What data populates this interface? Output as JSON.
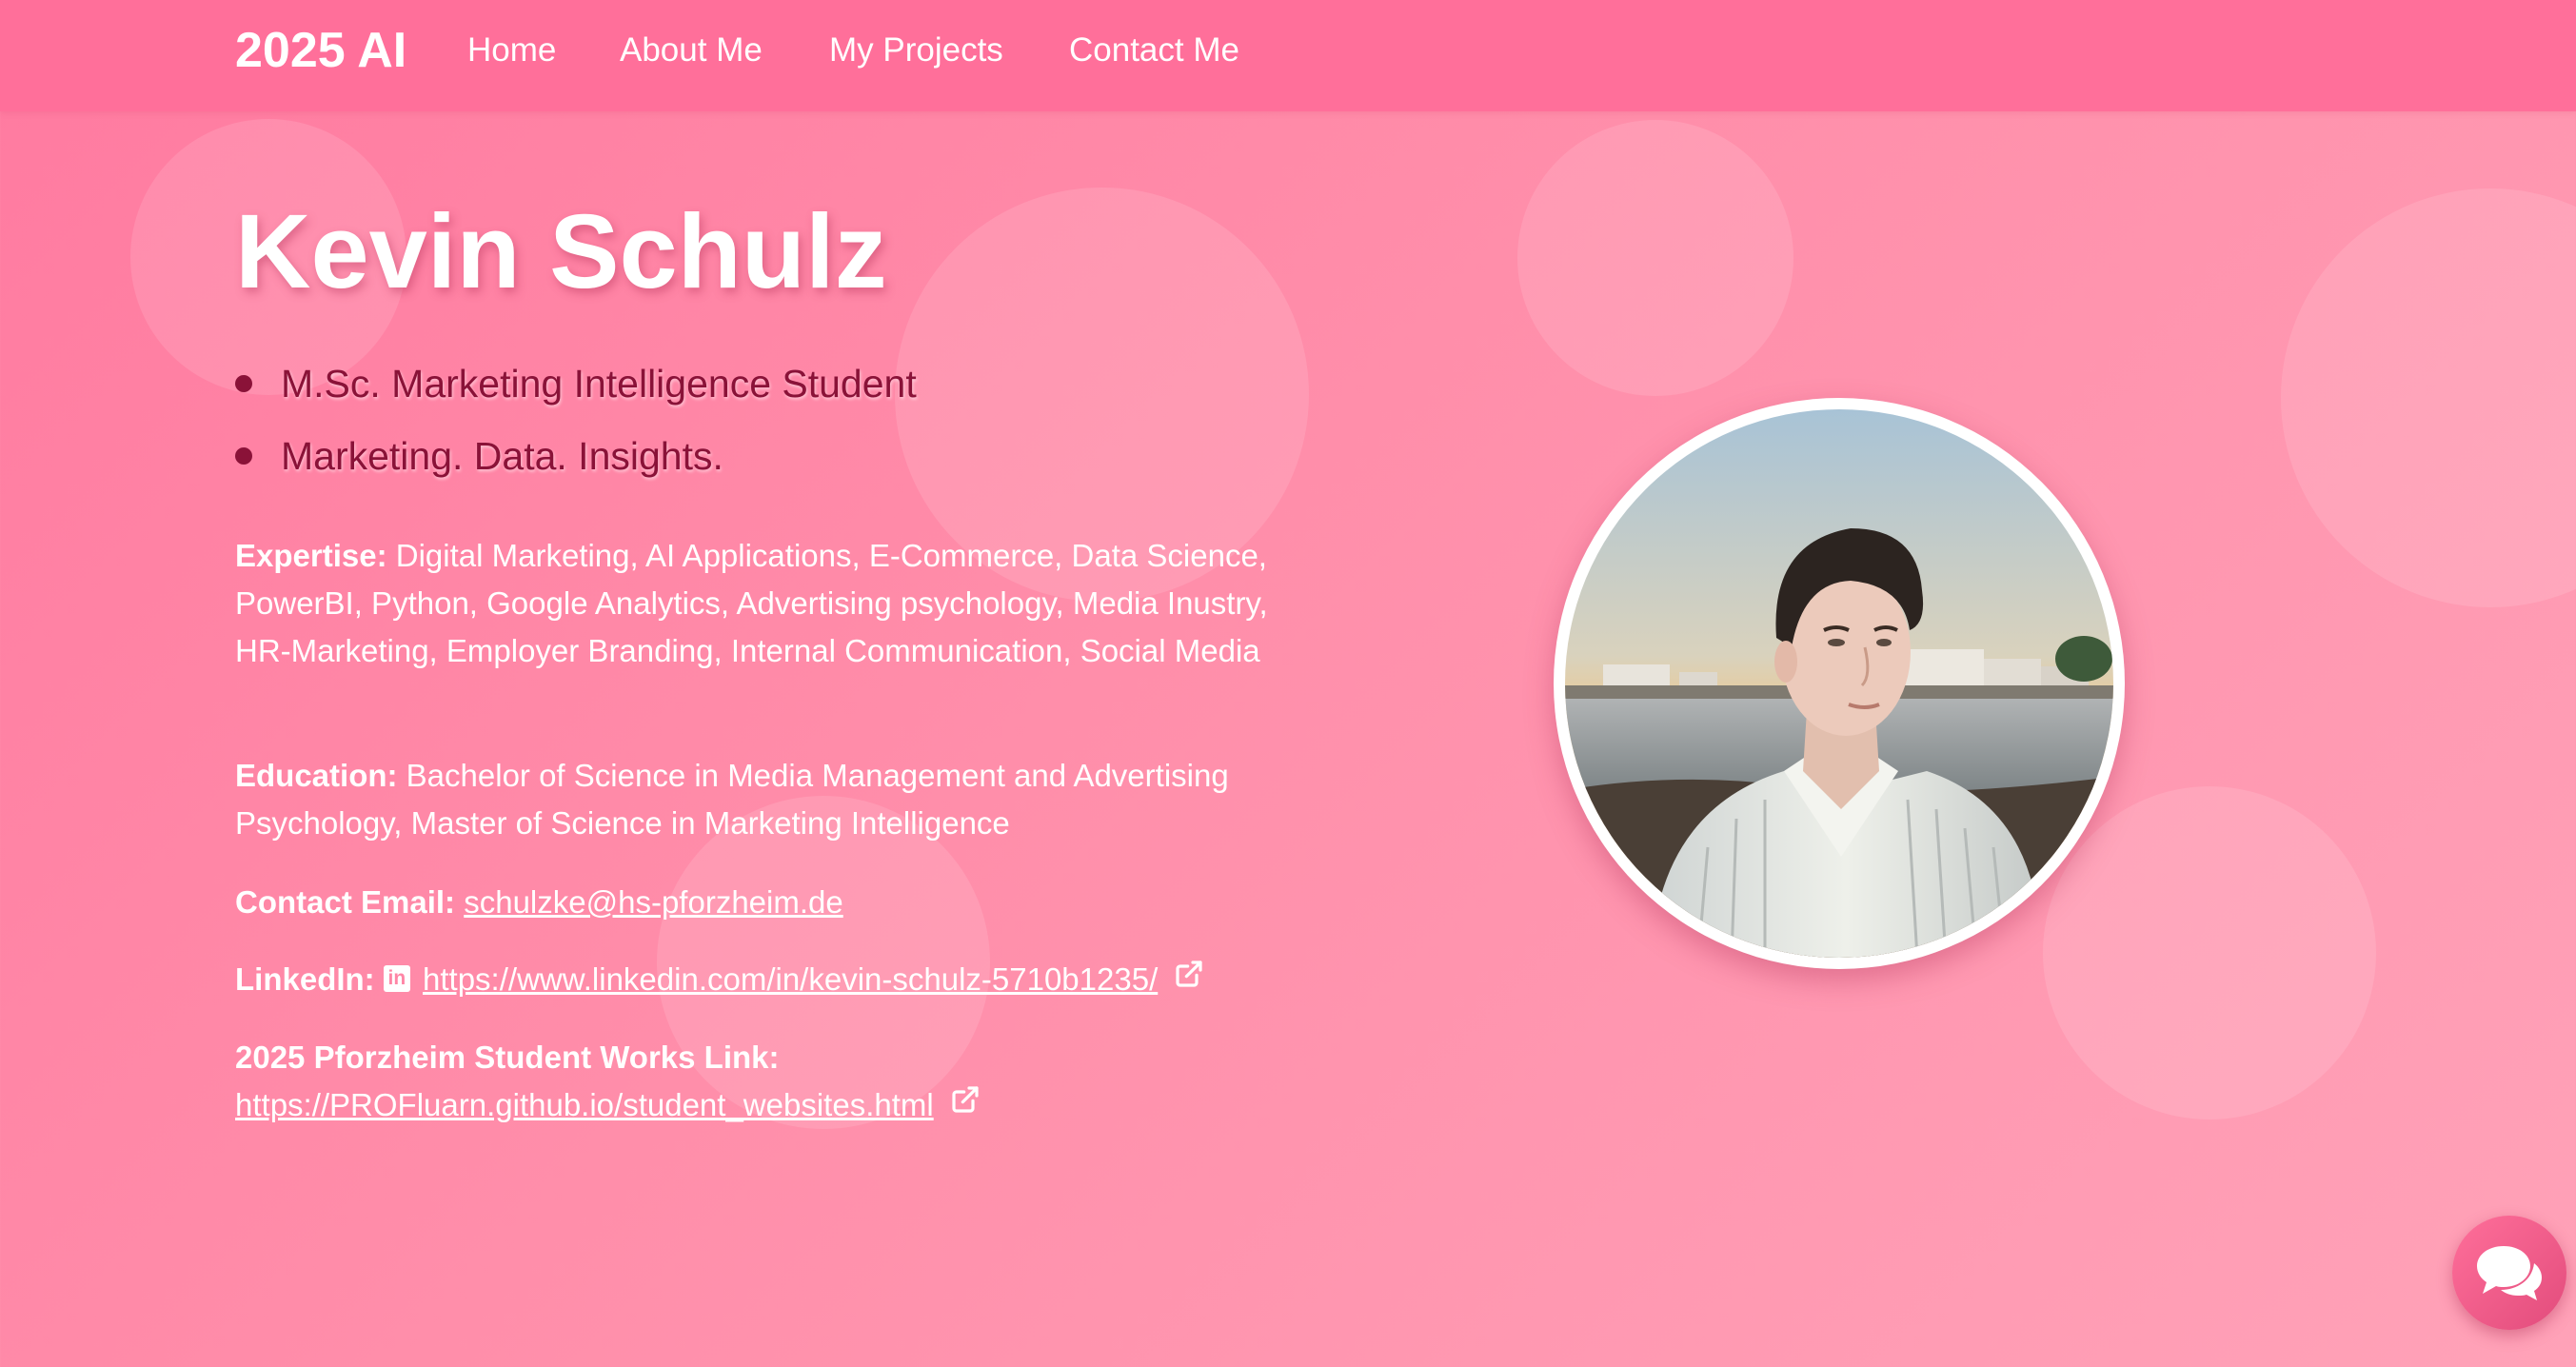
{
  "nav": {
    "brand": "2025 AI",
    "items": [
      "Home",
      "About Me",
      "My Projects",
      "Contact Me"
    ]
  },
  "hero": {
    "name": "Kevin Schulz",
    "taglines": [
      "M.Sc. Marketing Intelligence Student",
      "Marketing. Data. Insights."
    ]
  },
  "info": {
    "expertise_label": "Expertise:",
    "expertise_text": "Digital Marketing, AI Applications, E-Commerce, Data Science, PowerBI, Python, Google Analytics, Advertising psychology, Media Inustry, HR-Marketing, Employer Branding, Internal Communication, Social Media",
    "education_label": "Education:",
    "education_text": "Bachelor of Science in Media Management and Advertising Psychology, Master of Science in Marketing Intelligence",
    "email_label": "Contact Email:",
    "email": "schulzke@hs-pforzheim.de",
    "linkedin_label": "LinkedIn:",
    "linkedin_icon_text": "in",
    "linkedin_url": "https://www.linkedin.com/in/kevin-schulz-5710b1235/",
    "works_label": "2025 Pforzheim Student Works Link:",
    "works_url": "https://PROFluarn.github.io/student_websites.html"
  },
  "icons": {
    "linkedin": "linkedin-icon",
    "external": "external-link-icon",
    "chat": "chat-bubbles-icon"
  },
  "colors": {
    "navbar": "#ff6f9a",
    "background": "#ff8eaa",
    "tagline": "#8a1238",
    "text": "#ffffff"
  }
}
